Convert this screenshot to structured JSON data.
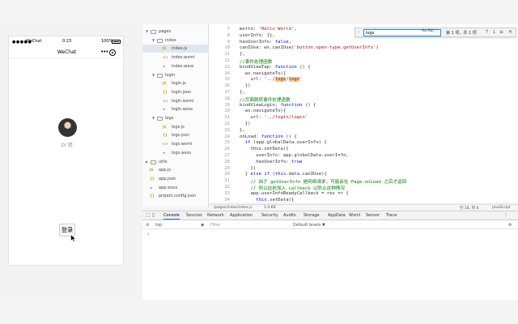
{
  "simulator": {
    "status_dots": "●●●●●",
    "carrier": "WeChat",
    "time": "0:23",
    "battery_pct": "100%",
    "nav_title": "WeChat",
    "more_glyph": "•••",
    "nickname": "Dr.鐿",
    "login_label": "登录"
  },
  "tree": {
    "items": [
      {
        "label": "pages",
        "depth": 0,
        "kind": "folder",
        "open": true
      },
      {
        "label": "index",
        "depth": 1,
        "kind": "folder",
        "open": true
      },
      {
        "label": "index.js",
        "depth": 2,
        "kind": "js",
        "selected": true
      },
      {
        "label": "index.wxml",
        "depth": 2,
        "kind": "wxml"
      },
      {
        "label": "index.wxss",
        "depth": 2,
        "kind": "wxss"
      },
      {
        "label": "login",
        "depth": 1,
        "kind": "folder",
        "open": true
      },
      {
        "label": "login.js",
        "depth": 2,
        "kind": "js"
      },
      {
        "label": "login.json",
        "depth": 2,
        "kind": "json"
      },
      {
        "label": "login.wxml",
        "depth": 2,
        "kind": "wxml"
      },
      {
        "label": "login.wxss",
        "depth": 2,
        "kind": "wxss"
      },
      {
        "label": "logs",
        "depth": 1,
        "kind": "folder",
        "open": true
      },
      {
        "label": "logs.js",
        "depth": 2,
        "kind": "js"
      },
      {
        "label": "logs.json",
        "depth": 2,
        "kind": "json"
      },
      {
        "label": "logs.wxml",
        "depth": 2,
        "kind": "wxml"
      },
      {
        "label": "logs.wxss",
        "depth": 2,
        "kind": "wxss"
      },
      {
        "label": "utils",
        "depth": 0,
        "kind": "folder",
        "open": false
      },
      {
        "label": "app.js",
        "depth": 0,
        "kind": "js"
      },
      {
        "label": "app.json",
        "depth": 0,
        "kind": "json"
      },
      {
        "label": "app.wxss",
        "depth": 0,
        "kind": "wxss"
      },
      {
        "label": "project.config.json",
        "depth": 0,
        "kind": "json"
      }
    ]
  },
  "editor": {
    "line_numbers": [
      "7",
      "8",
      "9",
      "10",
      "11",
      "12",
      "13",
      "14",
      "15",
      "16",
      "17",
      "18",
      "19",
      "20",
      "21",
      "22",
      "23",
      "24",
      "25",
      "26",
      "27",
      "28",
      "29",
      "30",
      "31",
      "32",
      "33",
      "34"
    ],
    "lines": [
      "motto: 'Hello World',",
      "userInfo: {},",
      "hasUserInfo: false,",
      "canIUse: wx.canIUse('button.open-type.getUserInfo')",
      "},",
      "//事件处理函数",
      "bindViewTap: function () {",
      "  wx.navigateTo({",
      "    url: '../logs/logs'",
      "  })",
      "},",
      "//页面跳转事件处理函数",
      "bindViewLogin: function () {",
      "  wx.navigateTo({",
      "    url: '../login/login'",
      "  })",
      "},",
      "onLoad: function () {",
      "  if (app.globalData.userInfo) {",
      "    this.setData({",
      "      userInfo: app.globalData.userInfo,",
      "      hasUserInfo: true",
      "    })",
      "  } else if (this.data.canIUse){",
      "    // 由于 getUserInfo 是网络请求，可能会在 Page.onLoad 之后才返回",
      "    // 所以此处加入 callback 以防止这种情况",
      "    app.userInfoReadyCallback = res => {",
      "      this.setData({"
    ],
    "find": {
      "value": "logs",
      "options": "Aa Ab| .*",
      "count": "第 1 项，共 1 项",
      "up": "↑",
      "down": "↓",
      "select": "≡",
      "close": "✕"
    },
    "status_path": "/pages/index/index.js",
    "status_size": "1.4 KB",
    "status_pos": "行 18, 列 8",
    "status_lang": "JavaScript"
  },
  "devtools": {
    "tabs": [
      "Console",
      "Sources",
      "Network",
      "Application",
      "Security",
      "Audits",
      "Storage",
      "AppData",
      "Wxml",
      "Sensor",
      "Trace"
    ],
    "active_tab": "Console",
    "context": "top",
    "filter_placeholder": "Filter",
    "levels": "Default levels ▼",
    "prompt": "›"
  },
  "colors": {
    "keyword": "#0000ff",
    "string": "#a31515",
    "comment": "#008000",
    "highlight": "#f6c88c",
    "selection": "#dfe6ee"
  }
}
